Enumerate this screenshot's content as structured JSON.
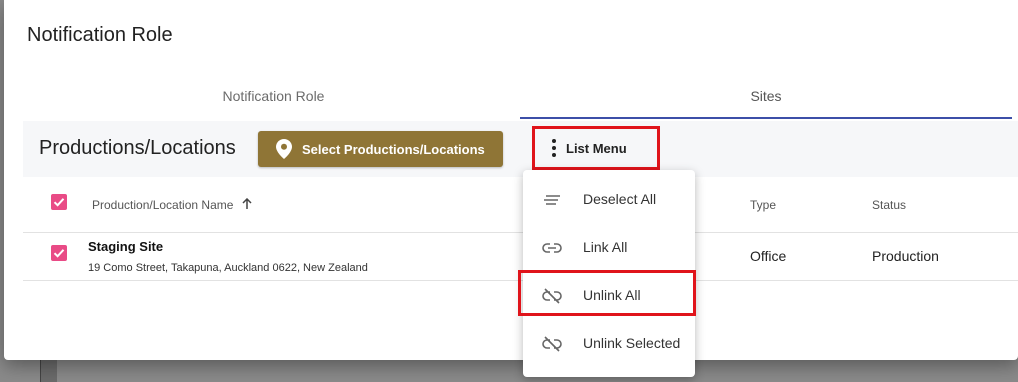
{
  "dialog": {
    "title": "Notification Role",
    "tabs": [
      {
        "label": "Notification Role",
        "active": false
      },
      {
        "label": "Sites",
        "active": true
      }
    ]
  },
  "toolbar": {
    "section_title": "Productions/Locations",
    "select_button_label": "Select Productions/Locations",
    "list_menu_label": "List Menu"
  },
  "table": {
    "columns": [
      "Production/Location Name",
      "Type",
      "Status"
    ],
    "sort_indicator": "arrow-up-icon",
    "header_checkbox_checked": true,
    "rows": [
      {
        "checked": true,
        "name": "Staging Site",
        "address": "19 Como Street, Takapuna, Auckland 0622, New Zealand",
        "type": "Office",
        "status": "Production"
      }
    ]
  },
  "list_menu": {
    "items": [
      {
        "label": "Deselect All",
        "icon": "deselect-lines-icon"
      },
      {
        "label": "Link All",
        "icon": "link-icon"
      },
      {
        "label": "Unlink All",
        "icon": "link-off-icon"
      },
      {
        "label": "Unlink Selected",
        "icon": "link-off-icon"
      }
    ]
  },
  "colors": {
    "accent_button": "#8f7536",
    "checkbox": "#e94b86",
    "tab_underline": "#3c4fa8",
    "highlight": "#e0141b"
  }
}
